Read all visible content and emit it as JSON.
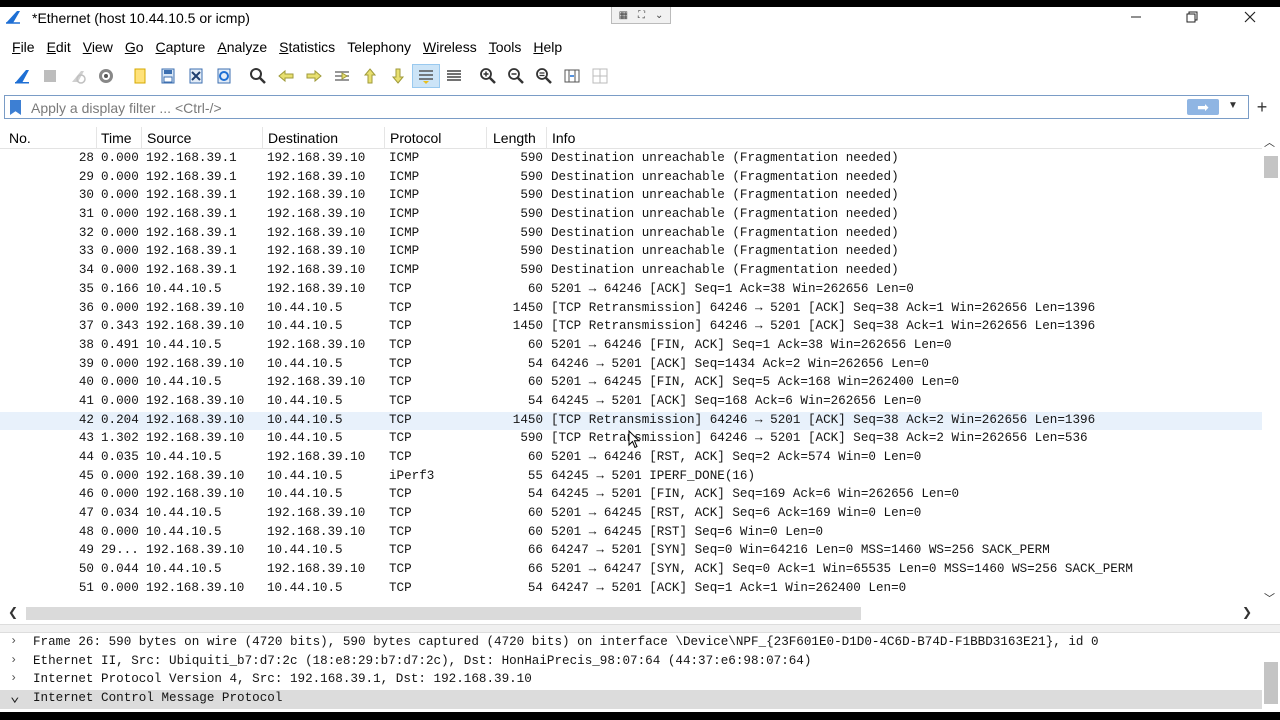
{
  "window": {
    "title": "*Ethernet (host 10.44.10.5 or icmp)",
    "accent": "#1e6fd4"
  },
  "menu": [
    {
      "first": "F",
      "rest": "ile"
    },
    {
      "first": "E",
      "rest": "dit"
    },
    {
      "first": "V",
      "rest": "iew"
    },
    {
      "first": "G",
      "rest": "o"
    },
    {
      "first": "C",
      "rest": "apture"
    },
    {
      "first": "A",
      "rest": "nalyze"
    },
    {
      "first": "S",
      "rest": "tatistics"
    },
    {
      "first": "",
      "rest": "Telephony"
    },
    {
      "first": "W",
      "rest": "ireless"
    },
    {
      "first": "T",
      "rest": "ools"
    },
    {
      "first": "H",
      "rest": "elp"
    }
  ],
  "filter": {
    "placeholder": "Apply a display filter ... <Ctrl-/>"
  },
  "columns": {
    "no": "No.",
    "time": "Time",
    "source": "Source",
    "destination": "Destination",
    "protocol": "Protocol",
    "length": "Length",
    "info": "Info"
  },
  "packets": [
    {
      "no": "28",
      "time": "0.000",
      "src": "192.168.39.1",
      "dst": "192.168.39.10",
      "proto": "ICMP",
      "len": "590",
      "info": "Destination unreachable (Fragmentation needed)"
    },
    {
      "no": "29",
      "time": "0.000",
      "src": "192.168.39.1",
      "dst": "192.168.39.10",
      "proto": "ICMP",
      "len": "590",
      "info": "Destination unreachable (Fragmentation needed)"
    },
    {
      "no": "30",
      "time": "0.000",
      "src": "192.168.39.1",
      "dst": "192.168.39.10",
      "proto": "ICMP",
      "len": "590",
      "info": "Destination unreachable (Fragmentation needed)"
    },
    {
      "no": "31",
      "time": "0.000",
      "src": "192.168.39.1",
      "dst": "192.168.39.10",
      "proto": "ICMP",
      "len": "590",
      "info": "Destination unreachable (Fragmentation needed)"
    },
    {
      "no": "32",
      "time": "0.000",
      "src": "192.168.39.1",
      "dst": "192.168.39.10",
      "proto": "ICMP",
      "len": "590",
      "info": "Destination unreachable (Fragmentation needed)"
    },
    {
      "no": "33",
      "time": "0.000",
      "src": "192.168.39.1",
      "dst": "192.168.39.10",
      "proto": "ICMP",
      "len": "590",
      "info": "Destination unreachable (Fragmentation needed)"
    },
    {
      "no": "34",
      "time": "0.000",
      "src": "192.168.39.1",
      "dst": "192.168.39.10",
      "proto": "ICMP",
      "len": "590",
      "info": "Destination unreachable (Fragmentation needed)"
    },
    {
      "no": "35",
      "time": "0.166",
      "src": "10.44.10.5",
      "dst": "192.168.39.10",
      "proto": "TCP",
      "len": "60",
      "info": "5201 → 64246 [ACK] Seq=1 Ack=38 Win=262656 Len=0"
    },
    {
      "no": "36",
      "time": "0.000",
      "src": "192.168.39.10",
      "dst": "10.44.10.5",
      "proto": "TCP",
      "len": "1450",
      "info": "[TCP Retransmission] 64246 → 5201 [ACK] Seq=38 Ack=1 Win=262656 Len=1396"
    },
    {
      "no": "37",
      "time": "0.343",
      "src": "192.168.39.10",
      "dst": "10.44.10.5",
      "proto": "TCP",
      "len": "1450",
      "info": "[TCP Retransmission] 64246 → 5201 [ACK] Seq=38 Ack=1 Win=262656 Len=1396"
    },
    {
      "no": "38",
      "time": "0.491",
      "src": "10.44.10.5",
      "dst": "192.168.39.10",
      "proto": "TCP",
      "len": "60",
      "info": "5201 → 64246 [FIN, ACK] Seq=1 Ack=38 Win=262656 Len=0"
    },
    {
      "no": "39",
      "time": "0.000",
      "src": "192.168.39.10",
      "dst": "10.44.10.5",
      "proto": "TCP",
      "len": "54",
      "info": "64246 → 5201 [ACK] Seq=1434 Ack=2 Win=262656 Len=0"
    },
    {
      "no": "40",
      "time": "0.000",
      "src": "10.44.10.5",
      "dst": "192.168.39.10",
      "proto": "TCP",
      "len": "60",
      "info": "5201 → 64245 [FIN, ACK] Seq=5 Ack=168 Win=262400 Len=0"
    },
    {
      "no": "41",
      "time": "0.000",
      "src": "192.168.39.10",
      "dst": "10.44.10.5",
      "proto": "TCP",
      "len": "54",
      "info": "64245 → 5201 [ACK] Seq=168 Ack=6 Win=262656 Len=0"
    },
    {
      "no": "42",
      "time": "0.204",
      "src": "192.168.39.10",
      "dst": "10.44.10.5",
      "proto": "TCP",
      "len": "1450",
      "info": "[TCP Retransmission] 64246 → 5201 [ACK] Seq=38 Ack=2 Win=262656 Len=1396"
    },
    {
      "no": "43",
      "time": "1.302",
      "src": "192.168.39.10",
      "dst": "10.44.10.5",
      "proto": "TCP",
      "len": "590",
      "info": "[TCP Retransmission] 64246 → 5201 [ACK] Seq=38 Ack=2 Win=262656 Len=536"
    },
    {
      "no": "44",
      "time": "0.035",
      "src": "10.44.10.5",
      "dst": "192.168.39.10",
      "proto": "TCP",
      "len": "60",
      "info": "5201 → 64246 [RST, ACK] Seq=2 Ack=574 Win=0 Len=0"
    },
    {
      "no": "45",
      "time": "0.000",
      "src": "192.168.39.10",
      "dst": "10.44.10.5",
      "proto": "iPerf3",
      "len": "55",
      "info": "64245 → 5201 IPERF_DONE(16)"
    },
    {
      "no": "46",
      "time": "0.000",
      "src": "192.168.39.10",
      "dst": "10.44.10.5",
      "proto": "TCP",
      "len": "54",
      "info": "64245 → 5201 [FIN, ACK] Seq=169 Ack=6 Win=262656 Len=0"
    },
    {
      "no": "47",
      "time": "0.034",
      "src": "10.44.10.5",
      "dst": "192.168.39.10",
      "proto": "TCP",
      "len": "60",
      "info": "5201 → 64245 [RST, ACK] Seq=6 Ack=169 Win=0 Len=0"
    },
    {
      "no": "48",
      "time": "0.000",
      "src": "10.44.10.5",
      "dst": "192.168.39.10",
      "proto": "TCP",
      "len": "60",
      "info": "5201 → 64245 [RST] Seq=6 Win=0 Len=0"
    },
    {
      "no": "49",
      "time": "29...",
      "src": "192.168.39.10",
      "dst": "10.44.10.5",
      "proto": "TCP",
      "len": "66",
      "info": "64247 → 5201 [SYN] Seq=0 Win=64216 Len=0 MSS=1460 WS=256 SACK_PERM"
    },
    {
      "no": "50",
      "time": "0.044",
      "src": "10.44.10.5",
      "dst": "192.168.39.10",
      "proto": "TCP",
      "len": "66",
      "info": "5201 → 64247 [SYN, ACK] Seq=0 Ack=1 Win=65535 Len=0 MSS=1460 WS=256 SACK_PERM"
    },
    {
      "no": "51",
      "time": "0.000",
      "src": "192.168.39.10",
      "dst": "10.44.10.5",
      "proto": "TCP",
      "len": "54",
      "info": "64247 → 5201 [ACK] Seq=1 Ack=1 Win=262400 Len=0"
    }
  ],
  "hover_row_no": "42",
  "details": [
    {
      "expanded": false,
      "text": "Frame 26: 590 bytes on wire (4720 bits), 590 bytes captured (4720 bits) on interface \\Device\\NPF_{23F601E0-D1D0-4C6D-B74D-F1BBD3163E21}, id 0"
    },
    {
      "expanded": false,
      "text": "Ethernet II, Src: Ubiquiti_b7:d7:2c (18:e8:29:b7:d7:2c), Dst: HonHaiPrecis_98:07:64 (44:37:e6:98:07:64)"
    },
    {
      "expanded": false,
      "text": "Internet Protocol Version 4, Src: 192.168.39.1, Dst: 192.168.39.10"
    },
    {
      "expanded": true,
      "text": "Internet Control Message Protocol"
    }
  ]
}
